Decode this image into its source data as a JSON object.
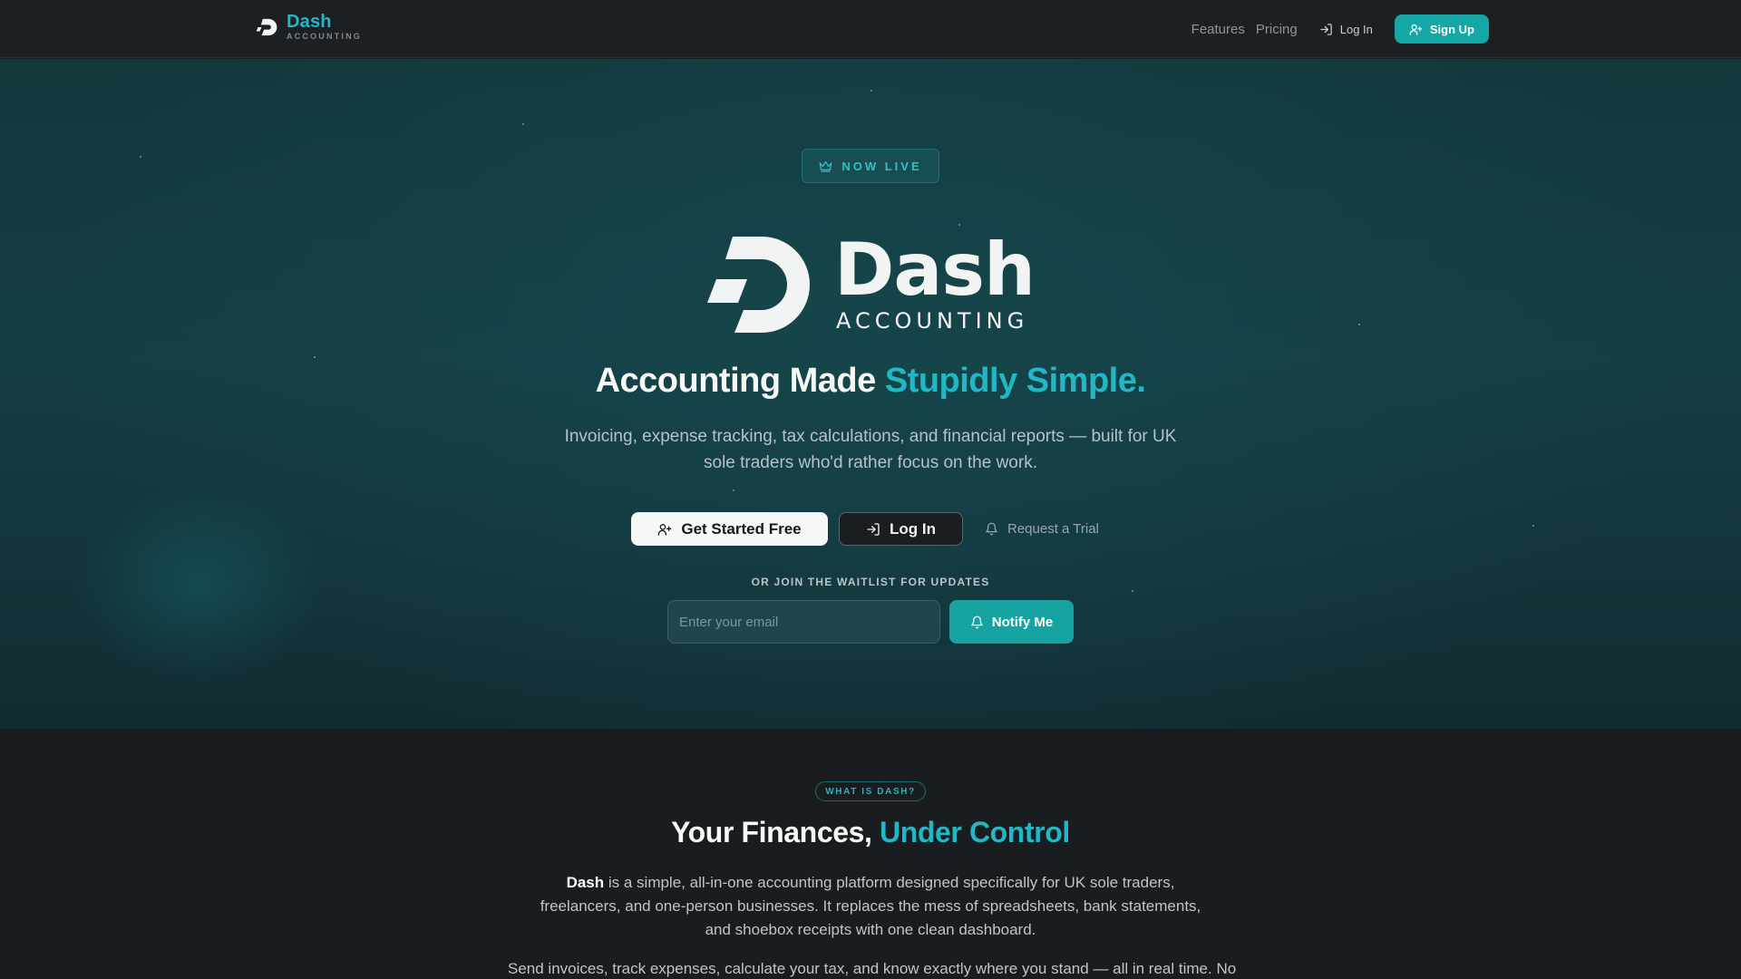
{
  "nav": {
    "brand_name": "Dash",
    "brand_sub": "ACCOUNTING",
    "links": [
      "Features",
      "Pricing"
    ],
    "login_label": "Log In",
    "signup_label": "Sign Up"
  },
  "hero": {
    "badge": "NOW LIVE",
    "logo_word": "Dash",
    "logo_sub": "ACCOUNTING",
    "title_main": "Accounting Made ",
    "title_accent": "Stupidly Simple.",
    "description": "Invoicing, expense tracking, tax calculations, and financial reports — built for UK sole traders who'd rather focus on the work.",
    "primary_cta": "Get Started Free",
    "secondary_cta": "Log In",
    "tertiary_cta": "Request a Trial",
    "waitlist_label": "OR JOIN THE WAITLIST FOR UPDATES",
    "email_placeholder": "Enter your email",
    "notify_label": "Notify Me"
  },
  "about": {
    "pill": "WHAT IS DASH?",
    "title_main": "Your Finances, ",
    "title_accent": "Under Control",
    "p1_strong": "Dash",
    "p1_rest": " is a simple, all-in-one accounting platform designed specifically for UK sole traders, freelancers, and one-person businesses. It replaces the mess of spreadsheets, bank statements, and shoebox receipts with one clean dashboard.",
    "p2": "Send invoices, track expenses, calculate your tax, and know exactly where you stand — all in real time. No"
  },
  "colors": {
    "accent": "#22b7c5",
    "button_teal": "#16a3a2",
    "hero_bg": "#153e44",
    "page_bg": "#1a1d20"
  },
  "icons": [
    "dash-logo-icon",
    "login-icon",
    "user-plus-icon",
    "crown-icon",
    "bell-icon"
  ]
}
